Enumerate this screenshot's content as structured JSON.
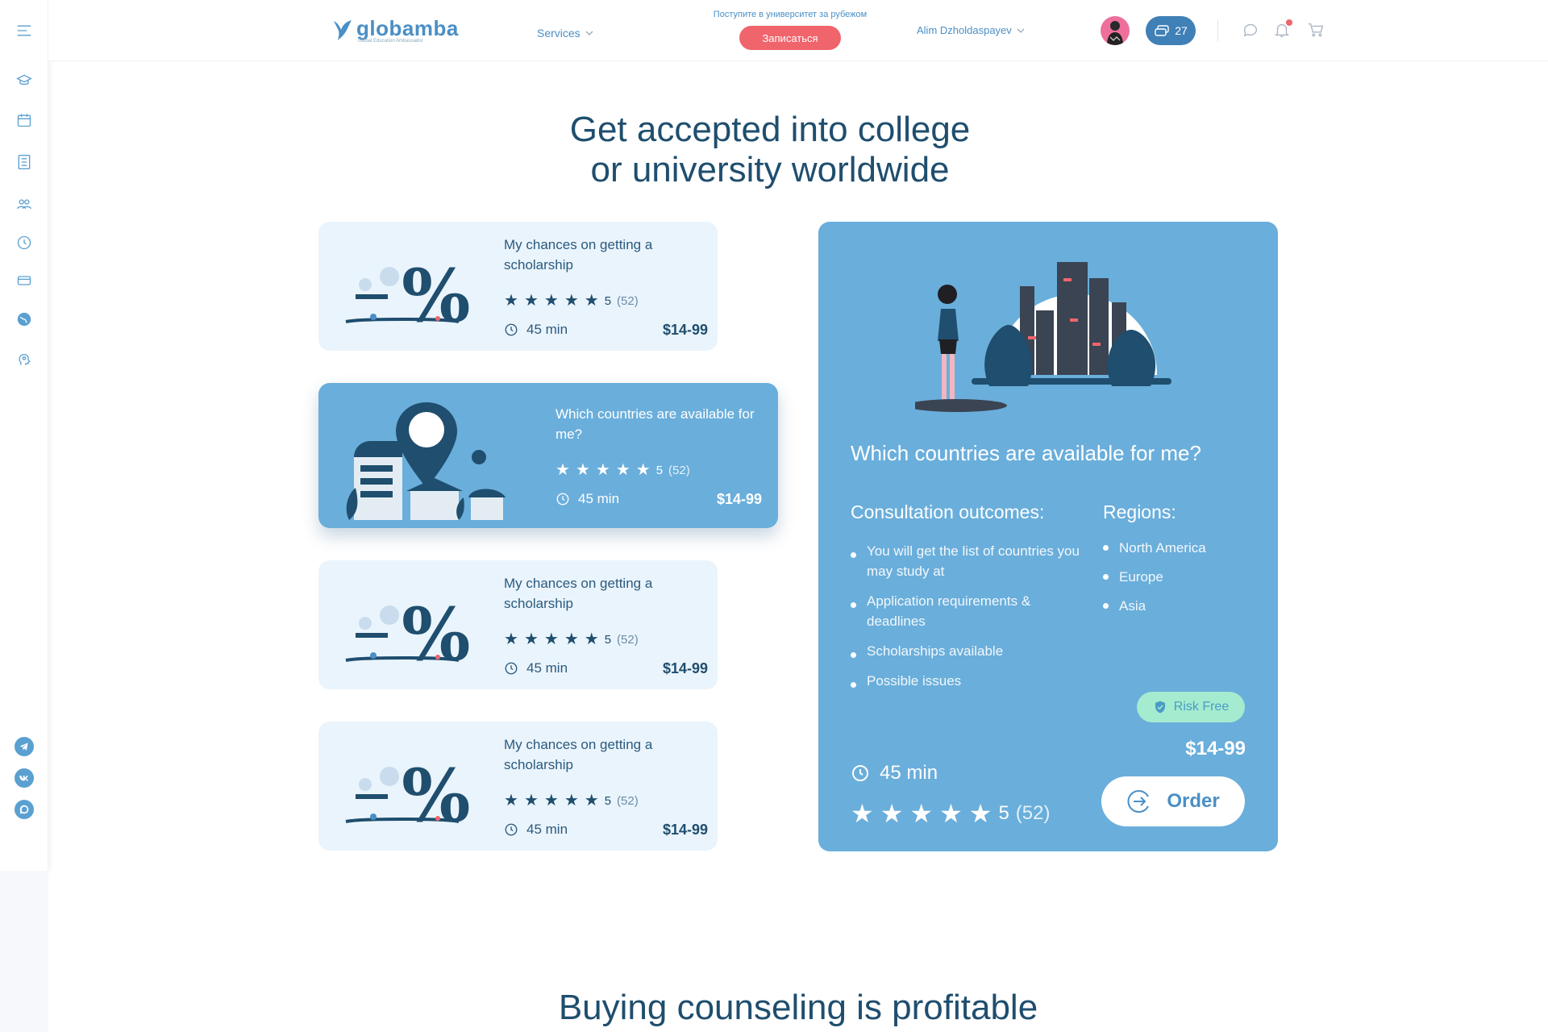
{
  "header": {
    "logo_text": "globamba",
    "logo_sub": "Global Education Ambassador",
    "services_label": "Services",
    "promo_text": "Поступите в университет за рубежом",
    "promo_button": "Записаться",
    "user_name": "Alim Dzholdaspayev",
    "coins": "27"
  },
  "hero": {
    "title_line1": "Get accepted into college",
    "title_line2": "or university worldwide"
  },
  "cards": [
    {
      "title": "My chances on getting a scholarship",
      "rating": "5",
      "reviews": "(52)",
      "duration": "45 min",
      "price": "$14-99"
    },
    {
      "title": "Which countries are available for me?",
      "rating": "5",
      "reviews": "(52)",
      "duration": "45 min",
      "price": "$14-99"
    },
    {
      "title": "My chances on getting a scholarship",
      "rating": "5",
      "reviews": "(52)",
      "duration": "45 min",
      "price": "$14-99"
    },
    {
      "title": "My chances on getting a scholarship",
      "rating": "5",
      "reviews": "(52)",
      "duration": "45 min",
      "price": "$14-99"
    }
  ],
  "detail": {
    "title": "Which countries are available for me?",
    "outcomes_title": "Consultation outcomes:",
    "outcomes": [
      "You will get the list of countries you may study at",
      "Application requirements  & deadlines",
      "Scholarships available",
      "Possible issues"
    ],
    "regions_title": "Regions:",
    "regions": [
      "North America",
      "Europe",
      "Asia"
    ],
    "risk_label": "Risk Free",
    "price": "$14-99",
    "duration": "45 min",
    "rating": "5",
    "reviews": "(52)",
    "order_label": "Order"
  },
  "section2": {
    "title": "Buying counseling is profitable"
  },
  "colors": {
    "primary": "#6aaedb",
    "dark": "#1f4e6e",
    "accent": "#f0646c",
    "card_bg": "#eaf4fc",
    "risk_bg": "#a5ebd0"
  },
  "icons": {
    "sidebar": [
      "menu-icon",
      "graduation-cap-icon",
      "calendar-icon",
      "checklist-icon",
      "group-icon",
      "clock-icon",
      "card-icon",
      "globe-icon",
      "head-icon"
    ],
    "social": [
      "telegram-icon",
      "vk-icon",
      "whatsapp-icon"
    ],
    "header": [
      "chat-icon",
      "bell-icon",
      "cart-icon"
    ]
  }
}
